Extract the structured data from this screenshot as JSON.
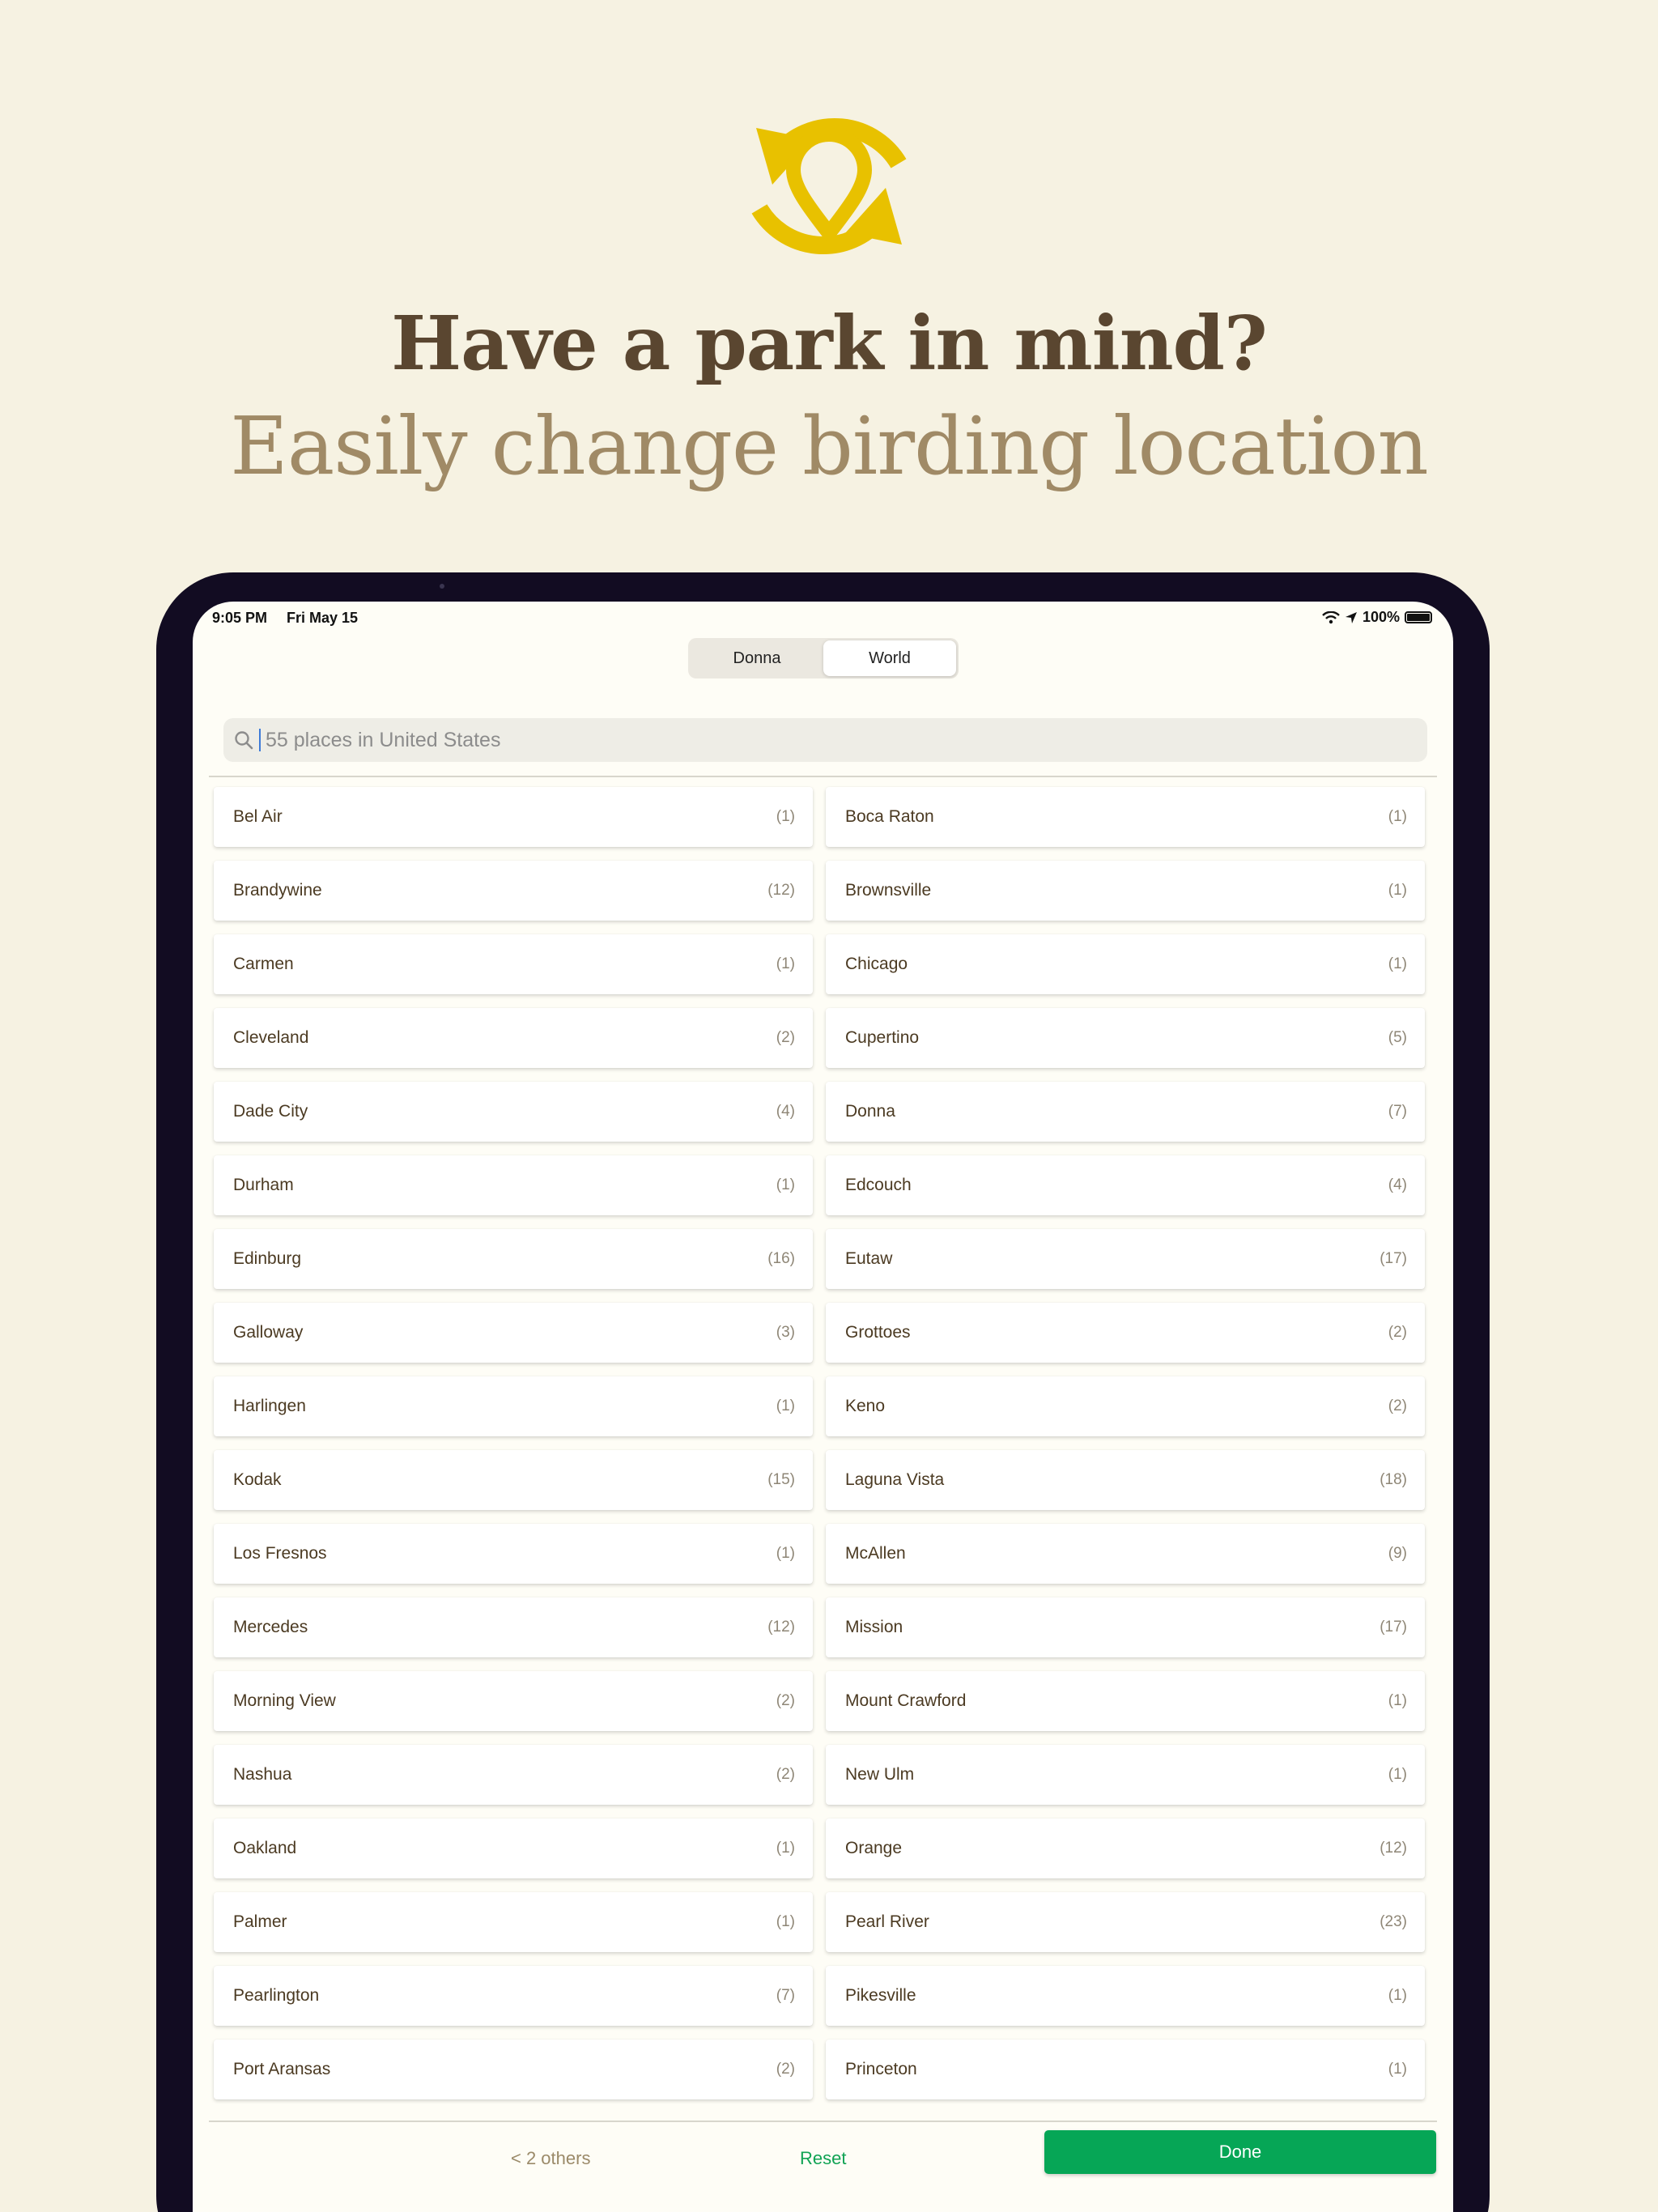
{
  "hero": {
    "headline": "Have a park in mind?",
    "subline": "Easily change birding location",
    "icon": "location-swap-icon",
    "accent_color": "#e8c100"
  },
  "status_bar": {
    "time": "9:05 PM",
    "date": "Fri May 15",
    "battery": "100%"
  },
  "segments": [
    "Donna",
    "World"
  ],
  "active_segment": "World",
  "search": {
    "placeholder": "55 places in United States"
  },
  "places": [
    {
      "name": "Bel Air",
      "count": "(1)"
    },
    {
      "name": "Boca Raton",
      "count": "(1)"
    },
    {
      "name": "Brandywine",
      "count": "(12)"
    },
    {
      "name": "Brownsville",
      "count": "(1)"
    },
    {
      "name": "Carmen",
      "count": "(1)"
    },
    {
      "name": "Chicago",
      "count": "(1)"
    },
    {
      "name": "Cleveland",
      "count": "(2)"
    },
    {
      "name": "Cupertino",
      "count": "(5)"
    },
    {
      "name": "Dade City",
      "count": "(4)"
    },
    {
      "name": "Donna",
      "count": "(7)"
    },
    {
      "name": "Durham",
      "count": "(1)"
    },
    {
      "name": "Edcouch",
      "count": "(4)"
    },
    {
      "name": "Edinburg",
      "count": "(16)"
    },
    {
      "name": "Eutaw",
      "count": "(17)"
    },
    {
      "name": "Galloway",
      "count": "(3)"
    },
    {
      "name": "Grottoes",
      "count": "(2)"
    },
    {
      "name": "Harlingen",
      "count": "(1)"
    },
    {
      "name": "Keno",
      "count": "(2)"
    },
    {
      "name": "Kodak",
      "count": "(15)"
    },
    {
      "name": "Laguna Vista",
      "count": "(18)"
    },
    {
      "name": "Los Fresnos",
      "count": "(1)"
    },
    {
      "name": "McAllen",
      "count": "(9)"
    },
    {
      "name": "Mercedes",
      "count": "(12)"
    },
    {
      "name": "Mission",
      "count": "(17)"
    },
    {
      "name": "Morning View",
      "count": "(2)"
    },
    {
      "name": "Mount Crawford",
      "count": "(1)"
    },
    {
      "name": "Nashua",
      "count": "(2)"
    },
    {
      "name": "New Ulm",
      "count": "(1)"
    },
    {
      "name": "Oakland",
      "count": "(1)"
    },
    {
      "name": "Orange",
      "count": "(12)"
    },
    {
      "name": "Palmer",
      "count": "(1)"
    },
    {
      "name": "Pearl River",
      "count": "(23)"
    },
    {
      "name": "Pearlington",
      "count": "(7)"
    },
    {
      "name": "Pikesville",
      "count": "(1)"
    },
    {
      "name": "Port Aransas",
      "count": "(2)"
    },
    {
      "name": "Princeton",
      "count": "(1)"
    }
  ],
  "footer": {
    "others_label": "< 2 others",
    "reset_label": "Reset",
    "done_label": "Done",
    "done_color": "#06a656"
  }
}
